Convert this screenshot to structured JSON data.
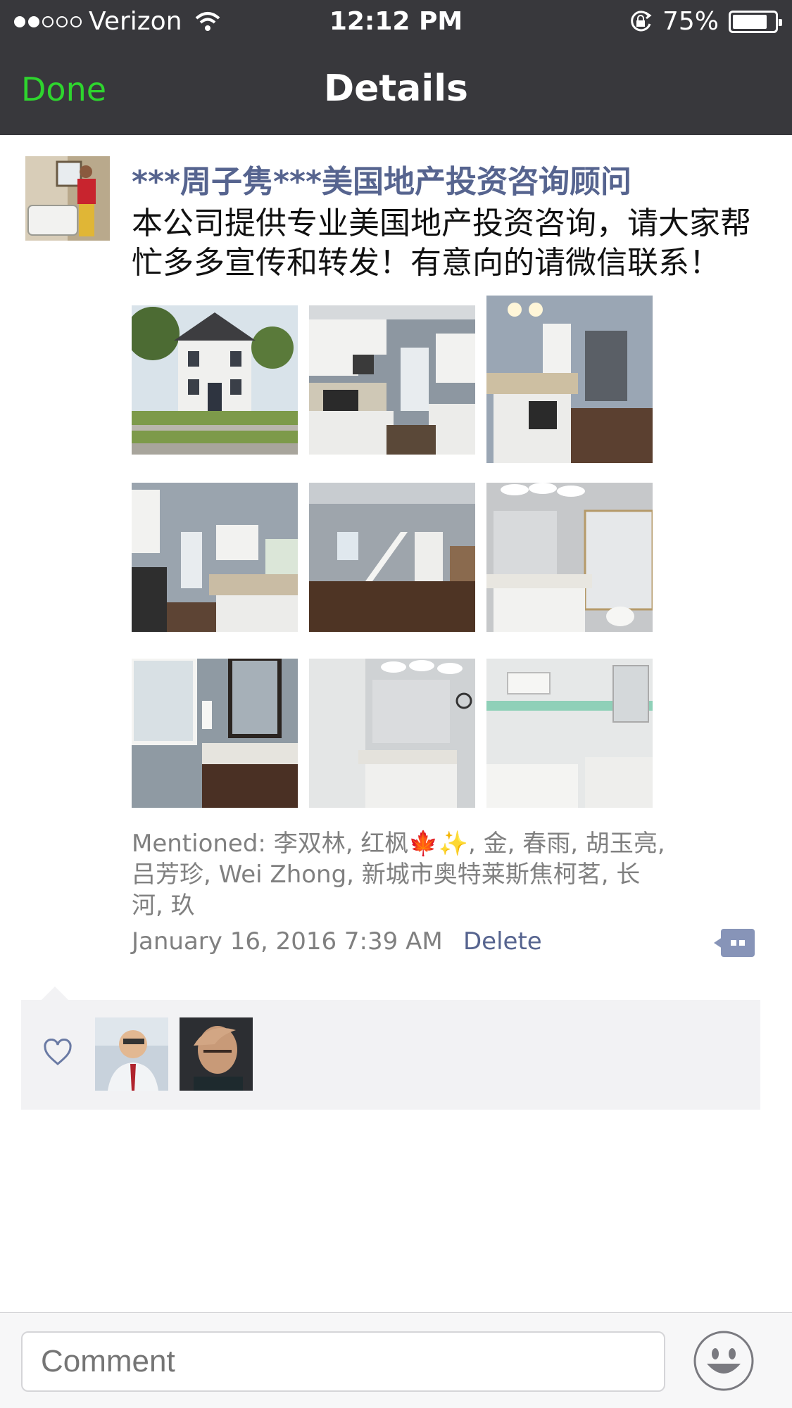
{
  "status_bar": {
    "carrier": "Verizon",
    "time": "12:12 PM",
    "battery": "75%"
  },
  "nav": {
    "done_label": "Done",
    "title": "Details"
  },
  "post": {
    "author": "***周子隽***美国地产投资咨询顾问",
    "text": "本公司提供专业美国地产投资咨询，请大家帮忙多多宣传和转发！有意向的请微信联系！",
    "photo_count": 9,
    "mentioned": "Mentioned: 李双林, 红枫🍁✨, 金, 春雨, 胡玉亮, 吕芳珍, Wei Zhong, 新城市奥特莱斯焦柯茗, 长河, 玖",
    "timestamp": "January 16, 2016 7:39 AM",
    "delete_label": "Delete"
  },
  "likes": {
    "count": 2
  },
  "comment_bar": {
    "placeholder": "Comment"
  },
  "colors": {
    "bar_bg": "#38383c",
    "done_green": "#2ed52e",
    "link_blue": "#56648f",
    "likes_bg": "#f2f2f4"
  },
  "icons": {
    "wifi": "wifi-icon",
    "rotation_lock": "rotation-lock-icon",
    "battery": "battery-icon",
    "comment": "comment-bubble-icon",
    "like": "heart-icon",
    "emoji": "smiley-icon"
  }
}
